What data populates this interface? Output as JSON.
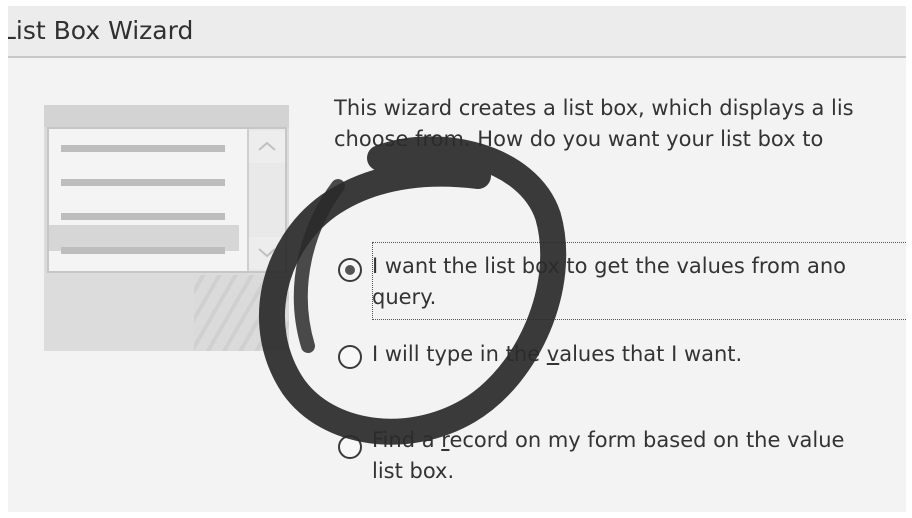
{
  "window": {
    "title": "List Box Wizard"
  },
  "intro": {
    "line1": "This wizard creates a list box, which displays a lis",
    "line2": "choose from.  How do you want your list box to"
  },
  "options": [
    {
      "line1": "I want the list box to get the values from ano",
      "line2": "query.",
      "selected": true
    },
    {
      "line1_pre": "I will type in the ",
      "line1_u": "v",
      "line1_post": "alues that I want.",
      "selected": false
    },
    {
      "line1_pre": "Find a ",
      "line1_u": "r",
      "line1_post": "ecord on my form based on the value",
      "line2": "list box.",
      "selected": false
    }
  ],
  "illustration": {
    "scroll_up_icon": "chevron-up-icon",
    "scroll_down_icon": "chevron-down-icon"
  },
  "colors": {
    "ink": "#2f2f2f",
    "dialog_bg": "#f1f1f1"
  }
}
